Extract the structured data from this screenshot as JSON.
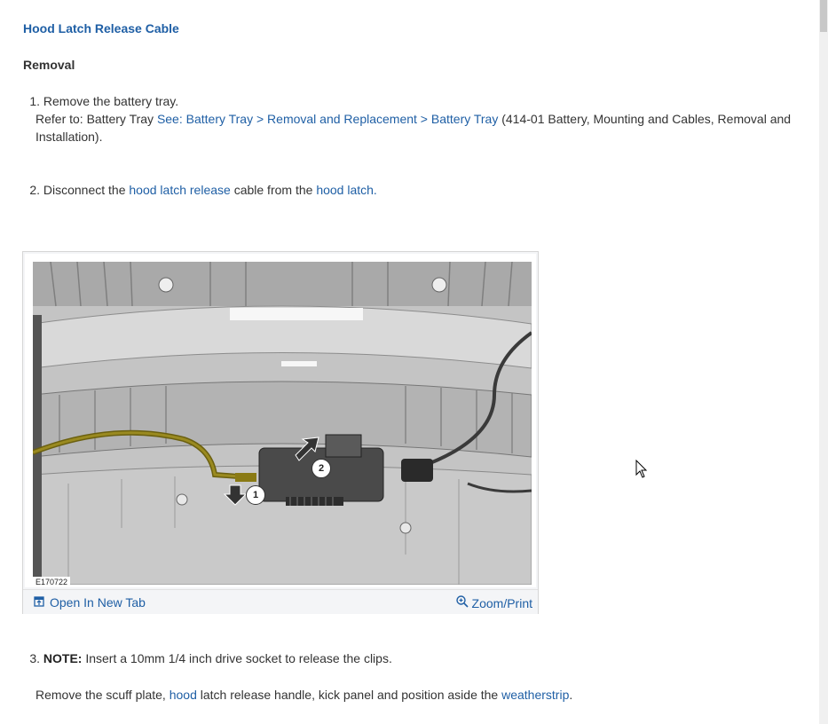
{
  "page": {
    "title": "Hood Latch Release Cable",
    "section": "Removal"
  },
  "steps": {
    "s1": {
      "num": "1.",
      "text": "Remove the battery tray.",
      "refer_prefix": "Refer to: Battery Tray ",
      "refer_link": "See: Battery Tray > Removal and Replacement > Battery Tray",
      "refer_suffix": " (414-01 Battery, Mounting and Cables, Removal and Installation)."
    },
    "s2": {
      "num": "2.",
      "t1": "Disconnect the ",
      "link1": "hood latch release",
      "t2": " cable from the ",
      "link2": "hood latch."
    },
    "s3": {
      "num": "3.",
      "note_label": "NOTE:",
      "note_text": " Insert a 10mm 1/4 inch drive socket to release the clips.",
      "t1": "Remove the scuff plate, ",
      "link1": "hood",
      "t2": " latch release handle, kick panel and position aside the ",
      "link2": "weatherstrip",
      "t3": "."
    }
  },
  "figure": {
    "code": "E170722",
    "callout1": "1",
    "callout2": "2",
    "open_label": "Open In New Tab",
    "zoom_label": "Zoom/Print"
  },
  "icons": {
    "open": "open-new-tab-icon",
    "zoom": "magnifier-icon"
  },
  "colors": {
    "link": "#1f5fa5",
    "cable": "#8a7a14"
  }
}
